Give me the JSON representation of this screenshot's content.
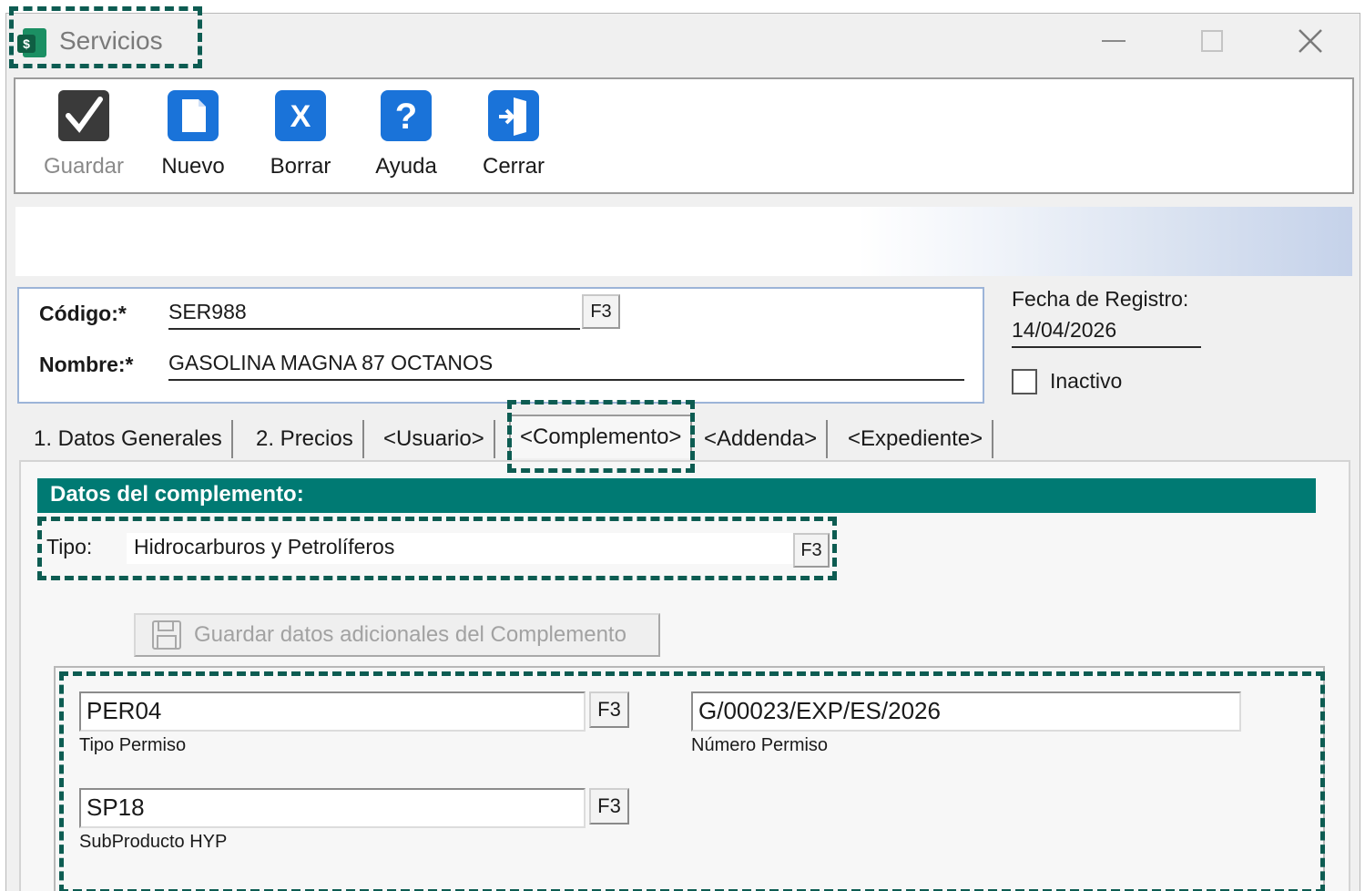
{
  "window": {
    "title": "Servicios"
  },
  "toolbar": {
    "save_label": "Guardar",
    "new_label": "Nuevo",
    "delete_label": "Borrar",
    "help_label": "Ayuda",
    "close_label": "Cerrar"
  },
  "form": {
    "codigo_label": "Código:*",
    "codigo_value": "SER988",
    "codigo_f3": "F3",
    "nombre_label": "Nombre:*",
    "nombre_value": "GASOLINA MAGNA 87 OCTANOS",
    "fecha_label": "Fecha de Registro:",
    "fecha_value": "14/04/2026",
    "inactivo_label": "Inactivo",
    "inactivo_checked": false
  },
  "tabs": [
    {
      "label": "1. Datos Generales",
      "active": false
    },
    {
      "label": "2. Precios",
      "active": false
    },
    {
      "label": "<Usuario>",
      "active": false
    },
    {
      "label": "<Complemento>",
      "active": true
    },
    {
      "label": "<Addenda>",
      "active": false
    },
    {
      "label": "<Expediente>",
      "active": false
    }
  ],
  "complemento": {
    "header": "Datos del complemento:",
    "tipo_label": "Tipo:",
    "tipo_value": "Hidrocarburos y Petrolíferos",
    "tipo_f3": "F3",
    "save_button": "Guardar datos adicionales del Complemento",
    "tipo_permiso_value": "PER04",
    "tipo_permiso_label": "Tipo Permiso",
    "tipo_permiso_f3": "F3",
    "numero_permiso_value": "G/00023/EXP/ES/2026",
    "numero_permiso_label": "Número Permiso",
    "subproducto_value": "SP18",
    "subproducto_label": "SubProducto HYP",
    "subproducto_f3": "F3"
  },
  "colors": {
    "accent": "#007a73",
    "highlight": "#0d5c52",
    "toolbar_icon": "#1a73d9"
  }
}
